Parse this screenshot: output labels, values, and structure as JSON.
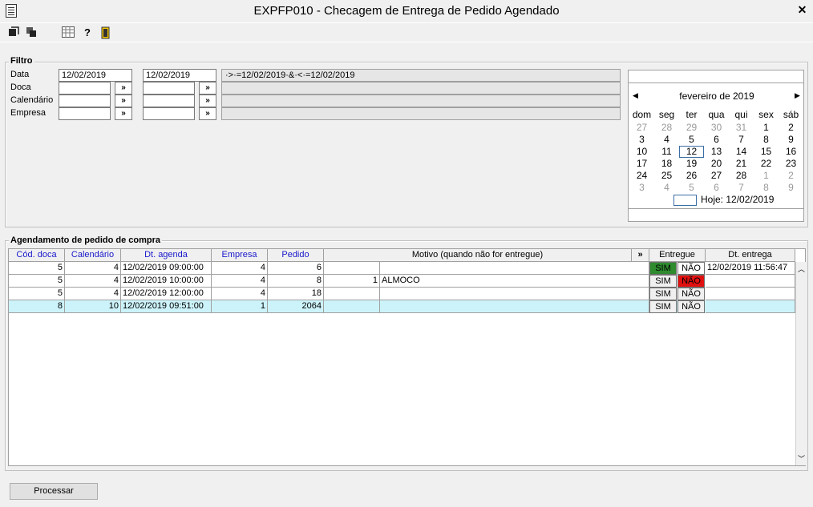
{
  "window": {
    "title": "EXPFP010 - Checagem de Entrega de Pedido Agendado",
    "close_icon": "close-icon"
  },
  "toolbar": {
    "icons": [
      "export-icon",
      "copy-icon",
      "grid-icon",
      "help-icon",
      "exit-door-icon"
    ]
  },
  "filter": {
    "legend": "Filtro",
    "rows": [
      {
        "label": "Data",
        "from": "12/02/2019",
        "to": "12/02/2019",
        "expr": "·>·=12/02/2019·&·<·=12/02/2019"
      },
      {
        "label": "Doca",
        "from": "",
        "to": "",
        "expr": ""
      },
      {
        "label": "Calendário",
        "from": "",
        "to": "",
        "expr": ""
      },
      {
        "label": "Empresa",
        "from": "",
        "to": "",
        "expr": ""
      }
    ],
    "lookup_label": "»"
  },
  "calendar": {
    "month": "fevereiro de 2019",
    "weekdays": [
      "dom",
      "seg",
      "ter",
      "qua",
      "qui",
      "sex",
      "sáb"
    ],
    "weeks": [
      [
        "27",
        "28",
        "29",
        "30",
        "31",
        "1",
        "2"
      ],
      [
        "3",
        "4",
        "5",
        "6",
        "7",
        "8",
        "9"
      ],
      [
        "10",
        "11",
        "12",
        "13",
        "14",
        "15",
        "16"
      ],
      [
        "17",
        "18",
        "19",
        "20",
        "21",
        "22",
        "23"
      ],
      [
        "24",
        "25",
        "26",
        "27",
        "28",
        "1",
        "2"
      ],
      [
        "3",
        "4",
        "5",
        "6",
        "7",
        "8",
        "9"
      ]
    ],
    "today": "Hoje: 12/02/2019"
  },
  "grid": {
    "legend": "Agendamento de pedido de compra",
    "columns": [
      "Cód. doca",
      "Calendário",
      "Dt. agenda",
      "Empresa",
      "Pedido",
      "Motivo (quando não for entregue)",
      "»",
      "Entregue",
      "Dt. entrega"
    ],
    "sim_label": "SIM",
    "nao_label": "NÃO",
    "rows": [
      {
        "doca": "5",
        "calendario": "4",
        "agenda": "12/02/2019 09:00:00",
        "empresa": "4",
        "pedido": "6",
        "motivo_cod": "",
        "motivo": "",
        "entregue": "SIM",
        "dt_entrega": "12/02/2019 11:56:47"
      },
      {
        "doca": "5",
        "calendario": "4",
        "agenda": "12/02/2019 10:00:00",
        "empresa": "4",
        "pedido": "8",
        "motivo_cod": "1",
        "motivo": "ALMOCO",
        "entregue": "NAO",
        "dt_entrega": ""
      },
      {
        "doca": "5",
        "calendario": "4",
        "agenda": "12/02/2019 12:00:00",
        "empresa": "4",
        "pedido": "18",
        "motivo_cod": "",
        "motivo": "",
        "entregue": "",
        "dt_entrega": ""
      },
      {
        "doca": "8",
        "calendario": "10",
        "agenda": "12/02/2019 09:51:00",
        "empresa": "1",
        "pedido": "2064",
        "motivo_cod": "",
        "motivo": "",
        "entregue": "",
        "dt_entrega": ""
      }
    ]
  },
  "actions": {
    "process_label": "Processar"
  },
  "colors": {
    "sim_active": "#2e8b2e",
    "nao_active": "#e01010",
    "selected_row": "#cdf3fa"
  }
}
